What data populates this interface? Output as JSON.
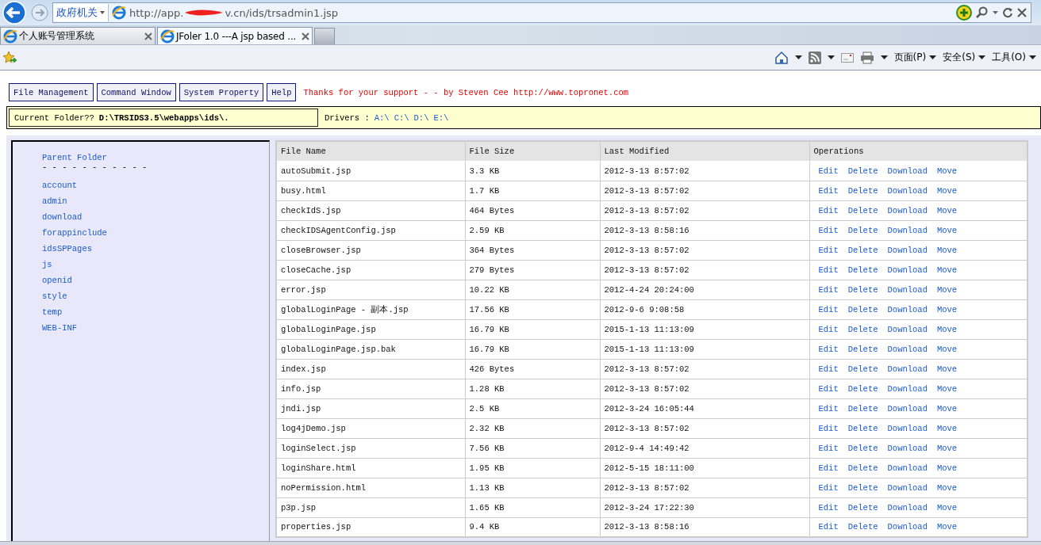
{
  "browser": {
    "zone": "政府机关",
    "address": {
      "prefix": "http://app.",
      "suffix": "v.cn/ids/trsadmin1.jsp"
    },
    "tabs": [
      {
        "title": "个人账号管理系统",
        "selected": false
      },
      {
        "title": "JFoler 1.0 ---A jsp based ...",
        "selected": true
      }
    ],
    "command_bar": {
      "menus": [
        "页面(P)",
        "安全(S)",
        "工具(O)"
      ]
    }
  },
  "page": {
    "nav_buttons": [
      "File Management",
      "Command Window",
      "System Property",
      "Help"
    ],
    "notice": "Thanks for your support - - by Steven Cee http://www.topronet.com",
    "current_folder": {
      "label": "Current Folder??",
      "path": "D:\\TRSIDS3.5\\webapps\\ids\\."
    },
    "drivers": {
      "label": "Drivers :",
      "links": [
        "A:\\",
        "C:\\",
        "D:\\",
        "E:\\"
      ]
    },
    "sidebar": {
      "parent": "Parent Folder",
      "separator": "- - - - - - - - - - -",
      "folders": [
        "account",
        "admin",
        "download",
        "forappinclude",
        "idsSPPages",
        "js",
        "openid",
        "style",
        "temp",
        "WEB-INF"
      ]
    },
    "table": {
      "columns": [
        "File Name",
        "File Size",
        "Last Modified",
        "Operations"
      ],
      "rows": [
        {
          "name": "autoSubmit.jsp",
          "size": "3.3 KB",
          "modified": "2012-3-13 8:57:02",
          "operations": [
            "Edit",
            "Delete",
            "Download",
            "Move"
          ]
        },
        {
          "name": "busy.html",
          "size": "1.7 KB",
          "modified": "2012-3-13 8:57:02",
          "operations": [
            "Edit",
            "Delete",
            "Download",
            "Move"
          ]
        },
        {
          "name": "checkIdS.jsp",
          "size": "464 Bytes",
          "modified": "2012-3-13 8:57:02",
          "operations": [
            "Edit",
            "Delete",
            "Download",
            "Move"
          ]
        },
        {
          "name": "checkIDSAgentConfig.jsp",
          "size": "2.59 KB",
          "modified": "2012-3-13 8:58:16",
          "operations": [
            "Edit",
            "Delete",
            "Download",
            "Move"
          ]
        },
        {
          "name": "closeBrowser.jsp",
          "size": "364 Bytes",
          "modified": "2012-3-13 8:57:02",
          "operations": [
            "Edit",
            "Delete",
            "Download",
            "Move"
          ]
        },
        {
          "name": "closeCache.jsp",
          "size": "279 Bytes",
          "modified": "2012-3-13 8:57:02",
          "operations": [
            "Edit",
            "Delete",
            "Download",
            "Move"
          ]
        },
        {
          "name": "error.jsp",
          "size": "10.22 KB",
          "modified": "2012-4-24 20:24:00",
          "operations": [
            "Edit",
            "Delete",
            "Download",
            "Move"
          ]
        },
        {
          "name": "globalLoginPage - 副本.jsp",
          "size": "17.56 KB",
          "modified": "2012-9-6 9:08:58",
          "operations": [
            "Edit",
            "Delete",
            "Download",
            "Move"
          ]
        },
        {
          "name": "globalLoginPage.jsp",
          "size": "16.79 KB",
          "modified": "2015-1-13 11:13:09",
          "operations": [
            "Edit",
            "Delete",
            "Download",
            "Move"
          ]
        },
        {
          "name": "globalLoginPage.jsp.bak",
          "size": "16.79 KB",
          "modified": "2015-1-13 11:13:09",
          "operations": [
            "Edit",
            "Delete",
            "Download",
            "Move"
          ]
        },
        {
          "name": "index.jsp",
          "size": "426 Bytes",
          "modified": "2012-3-13 8:57:02",
          "operations": [
            "Edit",
            "Delete",
            "Download",
            "Move"
          ]
        },
        {
          "name": "info.jsp",
          "size": "1.28 KB",
          "modified": "2012-3-13 8:57:02",
          "operations": [
            "Edit",
            "Delete",
            "Download",
            "Move"
          ]
        },
        {
          "name": "jndi.jsp",
          "size": "2.5 KB",
          "modified": "2012-3-24 16:05:44",
          "operations": [
            "Edit",
            "Delete",
            "Download",
            "Move"
          ]
        },
        {
          "name": "log4jDemo.jsp",
          "size": "2.32 KB",
          "modified": "2012-3-13 8:57:02",
          "operations": [
            "Edit",
            "Delete",
            "Download",
            "Move"
          ]
        },
        {
          "name": "loginSelect.jsp",
          "size": "7.56 KB",
          "modified": "2012-9-4 14:49:42",
          "operations": [
            "Edit",
            "Delete",
            "Download",
            "Move"
          ]
        },
        {
          "name": "loginShare.html",
          "size": "1.95 KB",
          "modified": "2012-5-15 18:11:00",
          "operations": [
            "Edit",
            "Delete",
            "Download",
            "Move"
          ]
        },
        {
          "name": "noPermission.html",
          "size": "1.13 KB",
          "modified": "2012-3-13 8:57:02",
          "operations": [
            "Edit",
            "Delete",
            "Download",
            "Move"
          ]
        },
        {
          "name": "p3p.jsp",
          "size": "1.65 KB",
          "modified": "2012-3-24 17:22:30",
          "operations": [
            "Edit",
            "Delete",
            "Download",
            "Move"
          ]
        },
        {
          "name": "properties.jsp",
          "size": "9.4 KB",
          "modified": "2012-3-13 8:58:16",
          "operations": [
            "Edit",
            "Delete",
            "Download",
            "Move"
          ]
        }
      ]
    }
  }
}
